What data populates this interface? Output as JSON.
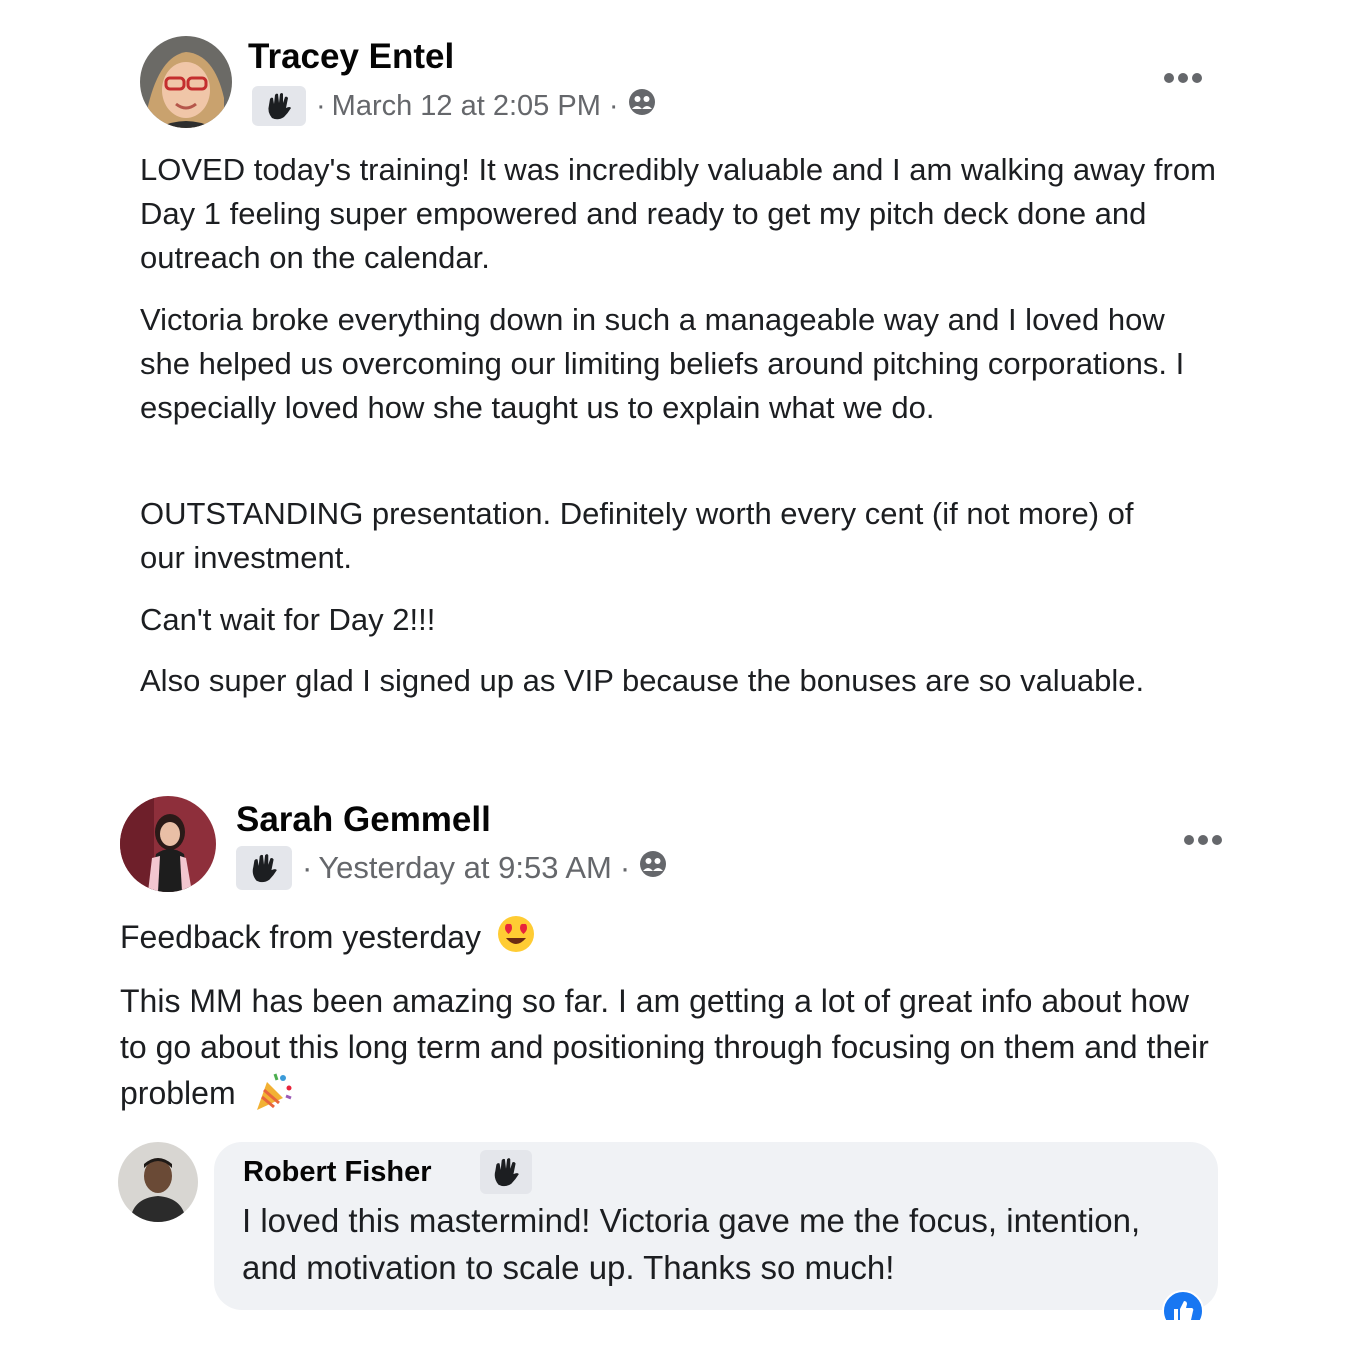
{
  "posts": [
    {
      "author": "Tracey Entel",
      "timestamp": "March 12 at 2:05 PM",
      "separator": "·",
      "badge_icon": "wave-hand-icon",
      "privacy_icon": "group-icon",
      "more_icon": "more-options-icon",
      "paragraphs": [
        "LOVED today's training! It was incredibly valuable and I am walking away from Day 1 feeling super empowered and ready to get my pitch deck done and outreach on the calendar.",
        "Victoria broke everything down in such a manageable way and I loved how she helped us overcoming our limiting beliefs around pitching corporations. I especially loved how she taught us to explain what we do.",
        "OUTSTANDING presentation. Definitely worth every cent (if not more) of our investment.",
        "Can't wait for Day 2!!!",
        "Also super glad I signed up as VIP because the bonuses are so valuable."
      ]
    },
    {
      "author": "Sarah Gemmell",
      "timestamp": "Yesterday at 9:53 AM",
      "separator": "·",
      "badge_icon": "wave-hand-icon",
      "privacy_icon": "group-icon",
      "more_icon": "more-options-icon",
      "paragraphs": [
        "Feedback from yesterday",
        "This MM has been amazing so far. I am getting a lot of great info about how to go about this long term and positioning through focusing on them and their problem"
      ],
      "emojis": [
        "heart-eyes-emoji",
        "party-popper-emoji"
      ]
    }
  ],
  "comment": {
    "author": "Robert Fisher",
    "text": "I loved this mastermind! Victoria gave me the focus, intention, and motivation to scale up. Thanks so much!",
    "badge_icon": "wave-hand-icon",
    "reaction_icon": "like-reaction-icon"
  },
  "colors": {
    "text": "#1c1e21",
    "meta": "#65676b",
    "comment_bg": "#f0f2f5",
    "like_blue": "#1877f2"
  }
}
